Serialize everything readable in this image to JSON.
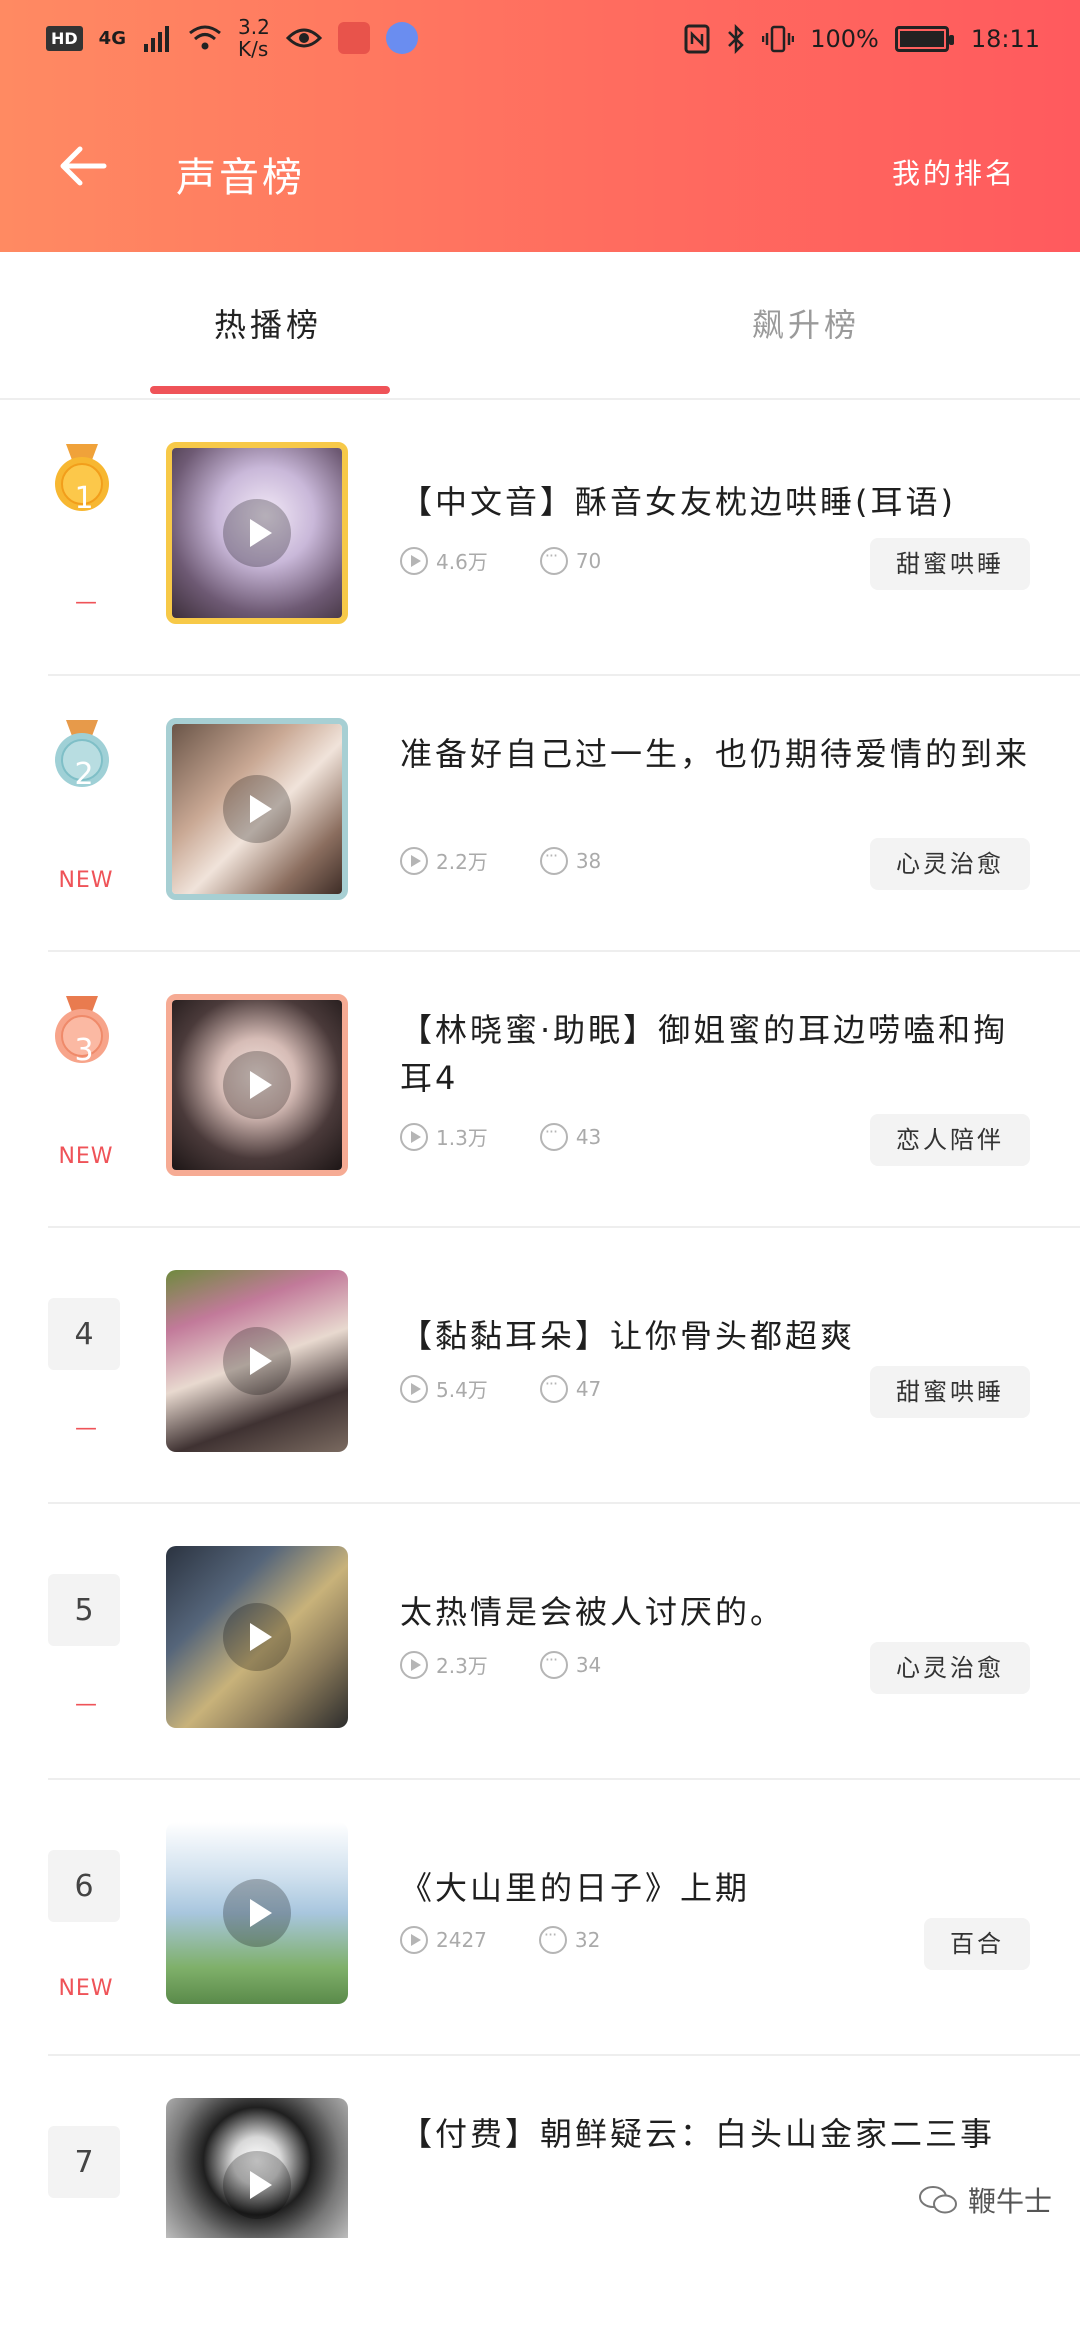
{
  "status_bar": {
    "hd": "HD",
    "network": "4G",
    "speed_value": "3.2",
    "speed_unit": "K/s",
    "battery": "100%",
    "time": "18:11"
  },
  "header": {
    "title": "声音榜",
    "right_link": "我的排名"
  },
  "tabs": [
    {
      "label": "热播榜",
      "active": true
    },
    {
      "label": "飙升榜",
      "active": false
    }
  ],
  "items": [
    {
      "rank": "1",
      "trend": "—",
      "title": "【中文音】酥音女友枕边哄睡(耳语)",
      "plays": "4.6万",
      "comments": "70",
      "tag": "甜蜜哄睡"
    },
    {
      "rank": "2",
      "trend": "NEW",
      "title": "准备好自己过一生，也仍期待爱情的到来",
      "plays": "2.2万",
      "comments": "38",
      "tag": "心灵治愈"
    },
    {
      "rank": "3",
      "trend": "NEW",
      "title": "【林晓蜜·助眠】御姐蜜的耳边唠嗑和掏耳4",
      "plays": "1.3万",
      "comments": "43",
      "tag": "恋人陪伴"
    },
    {
      "rank": "4",
      "trend": "—",
      "title": "【黏黏耳朵】让你骨头都超爽",
      "plays": "5.4万",
      "comments": "47",
      "tag": "甜蜜哄睡"
    },
    {
      "rank": "5",
      "trend": "—",
      "title": "太热情是会被人讨厌的。",
      "plays": "2.3万",
      "comments": "34",
      "tag": "心灵治愈"
    },
    {
      "rank": "6",
      "trend": "NEW",
      "title": "《大山里的日子》上期",
      "plays": "2427",
      "comments": "32",
      "tag": "百合"
    },
    {
      "rank": "7",
      "trend": "",
      "title": "【付费】朝鲜疑云：白头山金家二三事",
      "plays": "",
      "comments": "",
      "tag": ""
    }
  ],
  "watermark": "鞭牛士"
}
